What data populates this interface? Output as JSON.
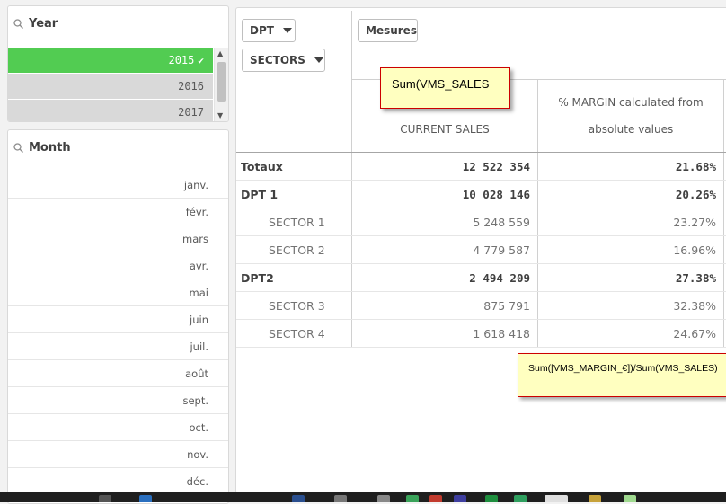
{
  "year_filter": {
    "title": "Year",
    "items": [
      {
        "label": "2015",
        "selected": true
      },
      {
        "label": "2016",
        "selected": false
      },
      {
        "label": "2017",
        "selected": false
      }
    ]
  },
  "month_filter": {
    "title": "Month",
    "items": [
      "janv.",
      "févr.",
      "mars",
      "avr.",
      "mai",
      "juin",
      "juil.",
      "août",
      "sept.",
      "oct.",
      "nov.",
      "déc."
    ]
  },
  "pivot": {
    "dimensions": [
      "DPT",
      "SECTORS"
    ],
    "measures_button": "Mesures",
    "columns": [
      "CURRENT SALES",
      "% MARGIN calculated from",
      "absolute values"
    ],
    "rows": [
      {
        "label": "Totaux",
        "sales": "12 522 354",
        "margin": "21.68%",
        "level": "total"
      },
      {
        "label": "DPT 1",
        "sales": "10 028 146",
        "margin": "20.26%",
        "level": "dpt"
      },
      {
        "label": "SECTOR 1",
        "sales": "5 248 559",
        "margin": "23.27%",
        "level": "sector"
      },
      {
        "label": "SECTOR 2",
        "sales": "4 779 587",
        "margin": "16.96%",
        "level": "sector"
      },
      {
        "label": "DPT2",
        "sales": "2 494 209",
        "margin": "27.38%",
        "level": "dpt"
      },
      {
        "label": "SECTOR 3",
        "sales": "875 791",
        "margin": "32.38%",
        "level": "sector"
      },
      {
        "label": "SECTOR 4",
        "sales": "1 618 418",
        "margin": "24.67%",
        "level": "sector"
      }
    ]
  },
  "annotations": {
    "sales_formula": "Sum(VMS_SALES",
    "margin_formula": "Sum([VMS_MARGIN_€])/Sum(VMS_SALES)"
  },
  "colors": {
    "selected": "#52cc52",
    "alternative": "#d9d9d9",
    "note_bg": "#ffffc0",
    "note_border": "#cc0000"
  }
}
